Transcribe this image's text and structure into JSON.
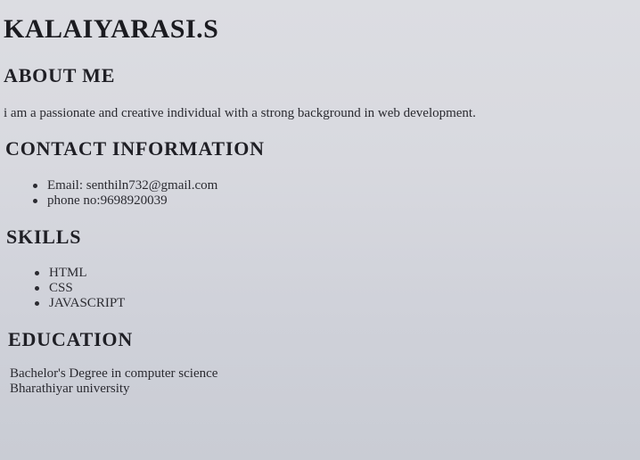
{
  "name": "KALAIYARASI.S",
  "about": {
    "heading": "ABOUT ME",
    "text": "i am a passionate and creative individual with a strong background in web development."
  },
  "contact": {
    "heading": "CONTACT INFORMATION",
    "items": [
      "Email: senthiln732@gmail.com",
      "phone no:9698920039"
    ]
  },
  "skills": {
    "heading": "SKILLS",
    "items": [
      "HTML",
      "CSS",
      "JAVASCRIPT"
    ]
  },
  "education": {
    "heading": "EDUCATION",
    "degree": "Bachelor's Degree in computer science",
    "institution": "Bharathiyar university"
  }
}
